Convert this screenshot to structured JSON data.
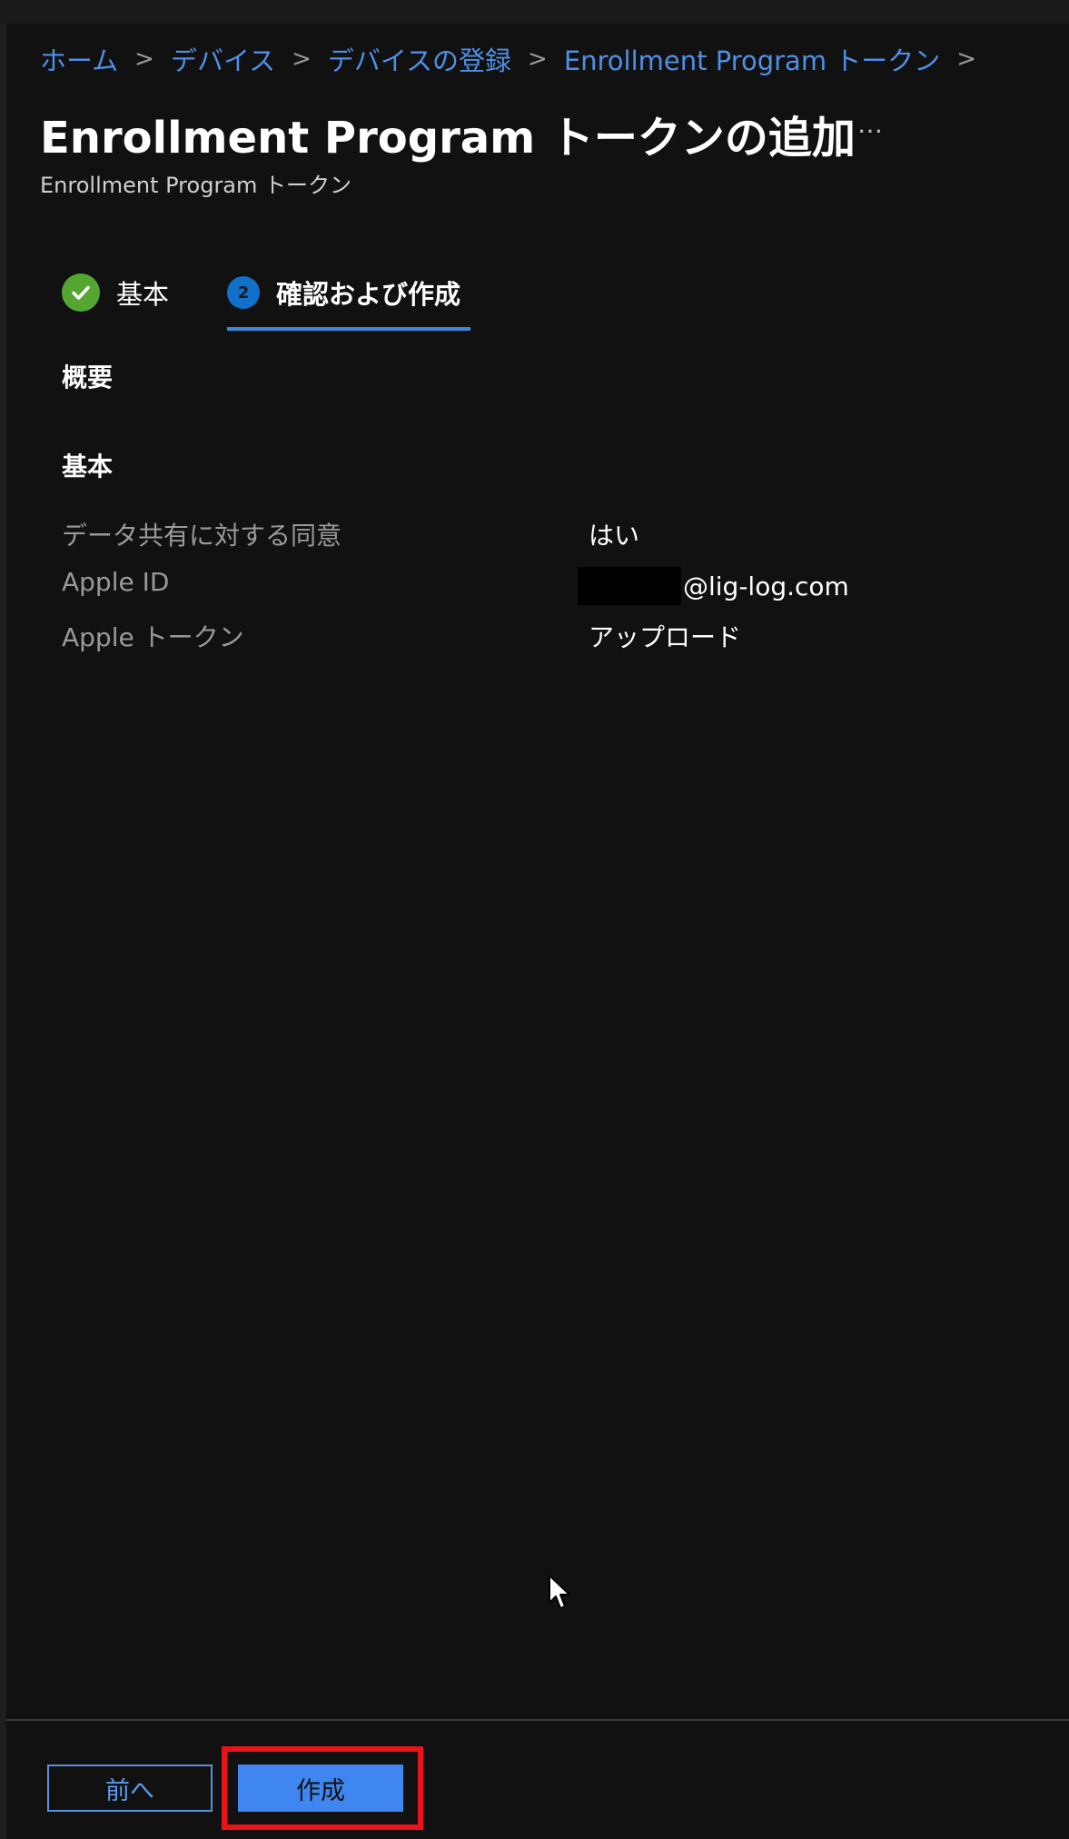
{
  "breadcrumb": [
    {
      "label": "ホーム"
    },
    {
      "label": "デバイス"
    },
    {
      "label": "デバイスの登録"
    },
    {
      "label": "Enrollment Program トークン"
    }
  ],
  "breadcrumb_separator": ">",
  "page": {
    "title": "Enrollment Program トークンの追加",
    "more_label": "…",
    "subtitle": "Enrollment Program トークン"
  },
  "steps": [
    {
      "label": "基本",
      "state": "completed"
    },
    {
      "number": "2",
      "label": "確認および作成",
      "state": "active"
    }
  ],
  "summary": {
    "heading": "概要",
    "section_title": "基本",
    "rows": [
      {
        "key": "データ共有に対する同意",
        "value": "はい"
      },
      {
        "key": "Apple ID",
        "value": "@lig-log.com"
      },
      {
        "key": "Apple トークン",
        "value": "アップロード"
      }
    ]
  },
  "footer": {
    "prev_label": "前へ",
    "create_label": "作成"
  },
  "colors": {
    "background": "#111111",
    "link": "#4f8fe6",
    "accent_blue": "#3f86f0",
    "success_green": "#55a630",
    "highlight_red": "#e8141a"
  }
}
